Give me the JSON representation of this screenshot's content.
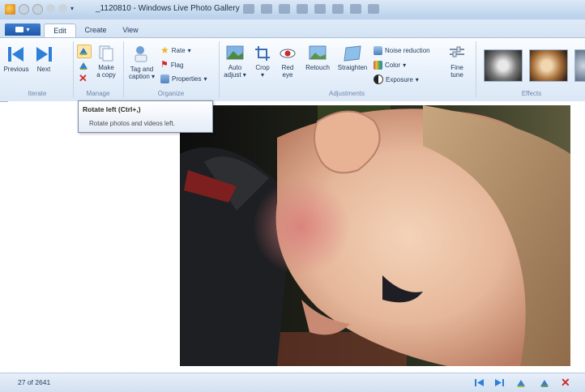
{
  "window": {
    "title": "_1120810 - Windows Live Photo Gallery"
  },
  "tabs": [
    {
      "label": "Edit"
    },
    {
      "label": "Create"
    },
    {
      "label": "View"
    }
  ],
  "ribbon": {
    "iterate": {
      "group": "Iterate",
      "previous": "Previous",
      "next": "Next"
    },
    "manage": {
      "group": "Manage",
      "make_copy_1": "Make",
      "make_copy_2": "a copy"
    },
    "organize": {
      "group": "Organize",
      "tag_caption_1": "Tag and",
      "tag_caption_2": "caption",
      "rate": "Rate",
      "flag": "Flag",
      "properties": "Properties"
    },
    "adjustments": {
      "group": "Adjustments",
      "auto_adjust_1": "Auto",
      "auto_adjust_2": "adjust",
      "crop": "Crop",
      "red_eye_1": "Red",
      "red_eye_2": "eye",
      "retouch": "Retouch",
      "straighten": "Straighten",
      "noise_reduction": "Noise reduction",
      "color": "Color",
      "exposure": "Exposure",
      "fine_tune_1": "Fine",
      "fine_tune_2": "tune"
    },
    "effects": {
      "group": "Effects"
    }
  },
  "tooltip": {
    "title": "Rotate left (Ctrl+,)",
    "description": "Rotate photos and videos left."
  },
  "status": {
    "count": "27 of 2641"
  },
  "colors": {
    "accent": "#1d56a8",
    "ribbon_bg": "#e4eefa",
    "delete_red": "#d22b2b"
  }
}
